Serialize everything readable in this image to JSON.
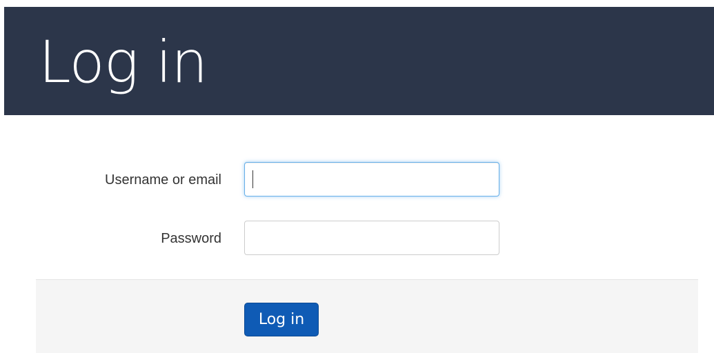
{
  "header": {
    "title": "Log in"
  },
  "form": {
    "username": {
      "label": "Username or email",
      "value": "",
      "placeholder": ""
    },
    "password": {
      "label": "Password",
      "value": "",
      "placeholder": ""
    },
    "submit_label": "Log in"
  },
  "colors": {
    "header_background": "#2c364a",
    "button_background": "#0f5bb5",
    "focus_border": "#66afe9",
    "actions_background": "#f5f5f5"
  }
}
